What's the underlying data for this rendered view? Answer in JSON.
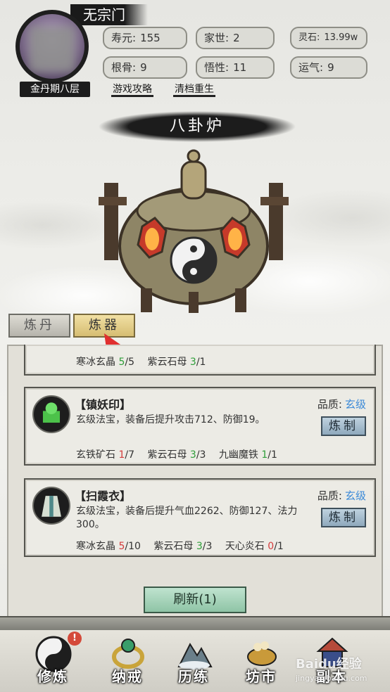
{
  "header": {
    "sect_name": "无宗门",
    "realm": "金丹期八层",
    "links": [
      "游戏攻略",
      "清档重生"
    ],
    "stats": [
      {
        "label": "寿元:",
        "value": "155"
      },
      {
        "label": "家世:",
        "value": "2"
      },
      {
        "label": "灵石:",
        "value": "13.99w"
      },
      {
        "label": "根骨:",
        "value": "9"
      },
      {
        "label": "悟性:",
        "value": "11"
      },
      {
        "label": "运气:",
        "value": "9"
      }
    ]
  },
  "title": "八卦炉",
  "tabs": [
    {
      "label": "炼丹",
      "active": false
    },
    {
      "label": "炼器",
      "active": true
    }
  ],
  "items": [
    {
      "partial": true,
      "materials": [
        {
          "name": "寒冰玄晶",
          "have": "5",
          "need": "/5",
          "ok": true
        },
        {
          "name": "紫云石母",
          "have": "3",
          "need": "/1",
          "ok": true
        }
      ]
    },
    {
      "name": "【镇妖印】",
      "quality_label": "品质:",
      "quality": "玄级",
      "desc": "玄级法宝，装备后提升攻击712、防御19。",
      "button": "炼制",
      "materials": [
        {
          "name": "玄铁矿石",
          "have": "1",
          "need": "/7",
          "ok": false
        },
        {
          "name": "紫云石母",
          "have": "3",
          "need": "/3",
          "ok": true
        },
        {
          "name": "九幽魔铁",
          "have": "1",
          "need": "/1",
          "ok": true
        }
      ]
    },
    {
      "name": "【扫霞衣】",
      "quality_label": "品质:",
      "quality": "玄级",
      "desc": "玄级法宝，装备后提升气血2262、防御127、法力300。",
      "button": "炼制",
      "materials": [
        {
          "name": "寒冰玄晶",
          "have": "5",
          "need": "/10",
          "ok": false
        },
        {
          "name": "紫云石母",
          "have": "3",
          "need": "/3",
          "ok": true
        },
        {
          "name": "天心炎石",
          "have": "0",
          "need": "/1",
          "ok": false
        }
      ]
    }
  ],
  "refresh": "刷新(1)",
  "nav": [
    {
      "label": "修炼",
      "icon": "taiji-icon"
    },
    {
      "label": "纳戒",
      "icon": "ring-icon"
    },
    {
      "label": "历练",
      "icon": "mountain-icon"
    },
    {
      "label": "坊市",
      "icon": "market-icon"
    },
    {
      "label": "副本",
      "icon": "pagoda-icon"
    }
  ],
  "badge": "!",
  "watermark": {
    "main": "Baidu经验",
    "sub": "jingyan.baidu.com"
  },
  "colors": {
    "quality": "#3b8ad8",
    "lack": "#d43c3c",
    "ok": "#2f9e3a"
  }
}
